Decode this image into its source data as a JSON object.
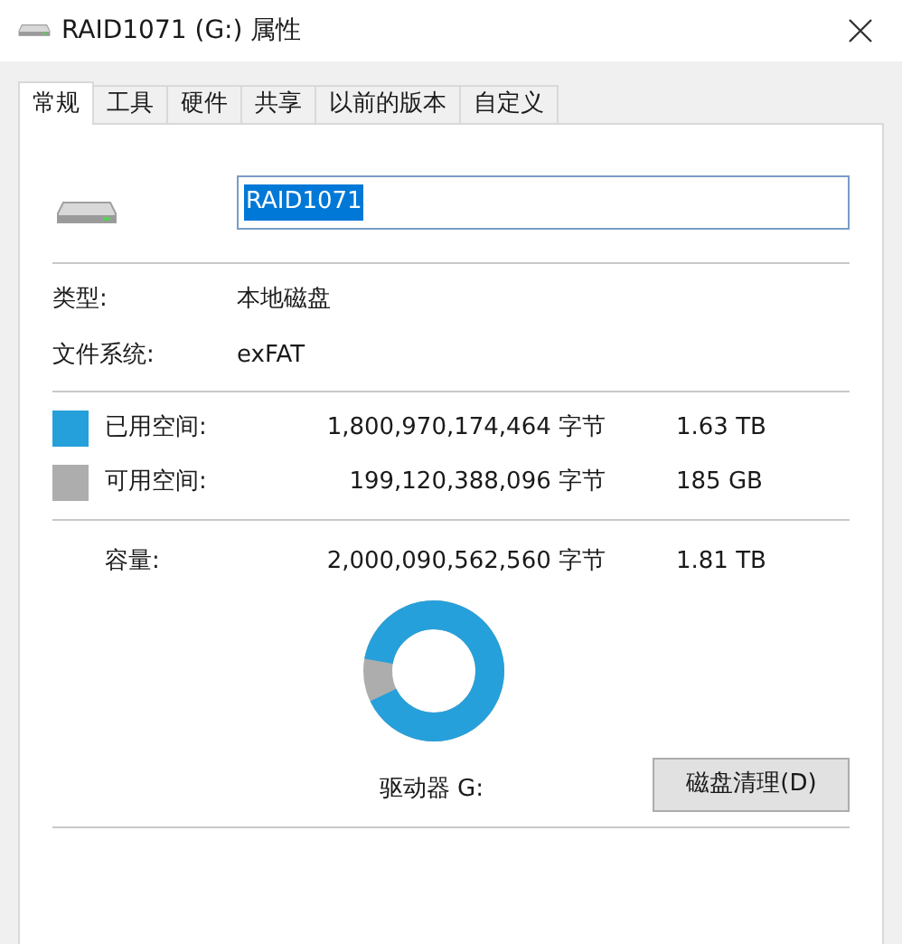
{
  "window": {
    "title": "RAID1071 (G:) 属性"
  },
  "tabs": [
    {
      "label": "常规",
      "selected": true
    },
    {
      "label": "工具",
      "selected": false
    },
    {
      "label": "硬件",
      "selected": false
    },
    {
      "label": "共享",
      "selected": false
    },
    {
      "label": "以前的版本",
      "selected": false
    },
    {
      "label": "自定义",
      "selected": false
    }
  ],
  "name_field": {
    "value": "RAID1071"
  },
  "info": [
    {
      "label": "类型:",
      "value": "本地磁盘"
    },
    {
      "label": "文件系统:",
      "value": "exFAT"
    }
  ],
  "space": [
    {
      "label": "已用空间:",
      "bytes": "1,800,970,174,464 字节",
      "size": "1.63 TB",
      "color": "#26a0da"
    },
    {
      "label": "可用空间:",
      "bytes": "199,120,388,096 字节",
      "size": "185 GB",
      "color": "#adadad"
    }
  ],
  "capacity": {
    "label": "容量:",
    "bytes": "2,000,090,562,560 字节",
    "size": "1.81 TB"
  },
  "drive_label": "驱动器 G:",
  "cleanup_button": "磁盘清理(D)"
}
